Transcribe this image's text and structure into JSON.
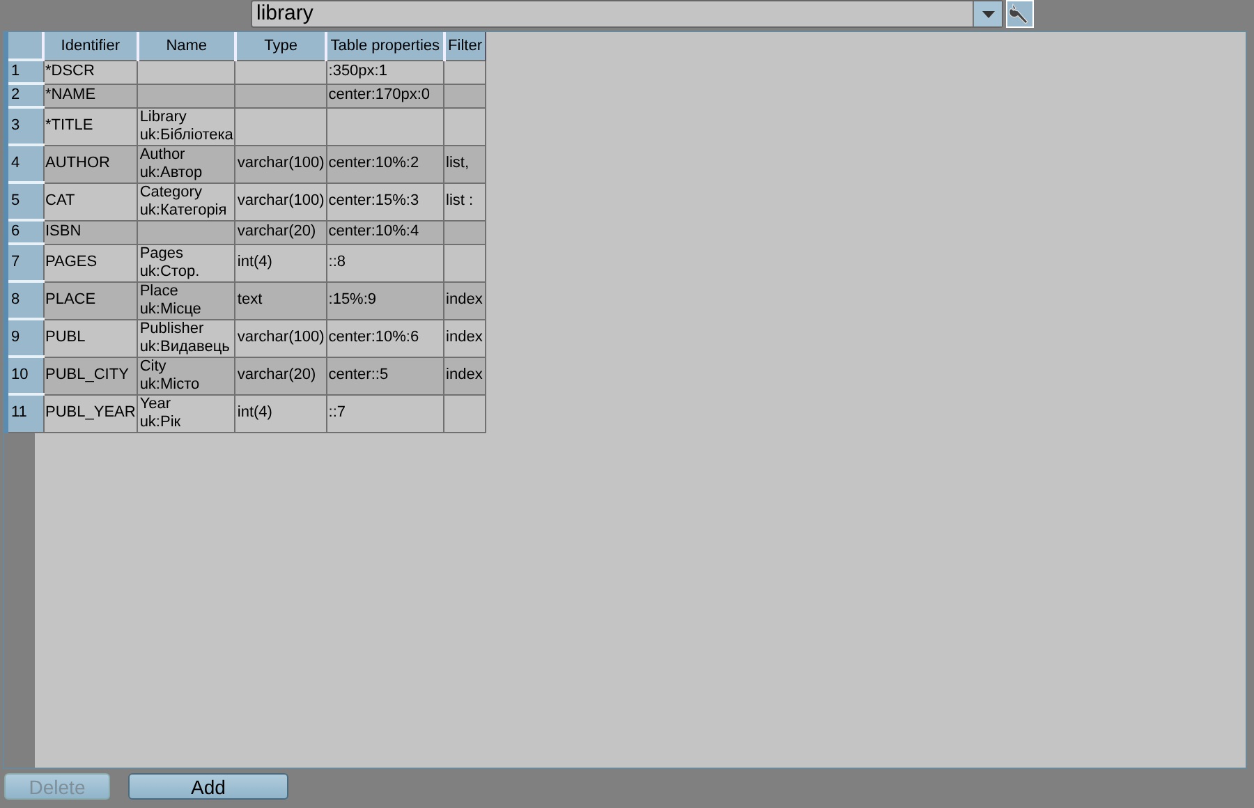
{
  "selector": {
    "value": "library"
  },
  "table": {
    "columns": [
      "Identifier",
      "Name",
      "Type",
      "Table properties",
      "Filter"
    ],
    "rows": [
      {
        "number": "1",
        "cells": [
          "*DSCR",
          "",
          "",
          ":350px:1",
          ""
        ]
      },
      {
        "number": "2",
        "cells": [
          "*NAME",
          "",
          "",
          "center:170px:0",
          ""
        ]
      },
      {
        "number": "3",
        "cells": [
          "*TITLE",
          "Library\nuk:Бібліотека",
          "",
          "",
          ""
        ]
      },
      {
        "number": "4",
        "cells": [
          "AUTHOR",
          "Author\nuk:Автор",
          "varchar(100)",
          "center:10%:2",
          "list,"
        ]
      },
      {
        "number": "5",
        "cells": [
          "CAT",
          "Category\nuk:Категорія",
          "varchar(100)",
          "center:15%:3",
          "list :"
        ]
      },
      {
        "number": "6",
        "cells": [
          "ISBN",
          "",
          "varchar(20)",
          "center:10%:4",
          ""
        ]
      },
      {
        "number": "7",
        "cells": [
          "PAGES",
          "Pages\nuk:Стор.",
          "int(4)",
          "::8",
          ""
        ]
      },
      {
        "number": "8",
        "cells": [
          "PLACE",
          "Place\nuk:Місце",
          "text",
          ":15%:9",
          "index"
        ]
      },
      {
        "number": "9",
        "cells": [
          "PUBL",
          "Publisher\nuk:Видавець",
          "varchar(100)",
          "center:10%:6",
          "index"
        ]
      },
      {
        "number": "10",
        "cells": [
          "PUBL_CITY",
          "City\nuk:Місто",
          "varchar(20)",
          "center::5",
          "index"
        ]
      },
      {
        "number": "11",
        "cells": [
          "PUBL_YEAR",
          "Year\nuk:Рік",
          "int(4)",
          "::7",
          ""
        ]
      }
    ]
  },
  "buttons": [
    {
      "label": "Delete",
      "disabled": true
    },
    {
      "label": "Add",
      "disabled": false
    }
  ]
}
